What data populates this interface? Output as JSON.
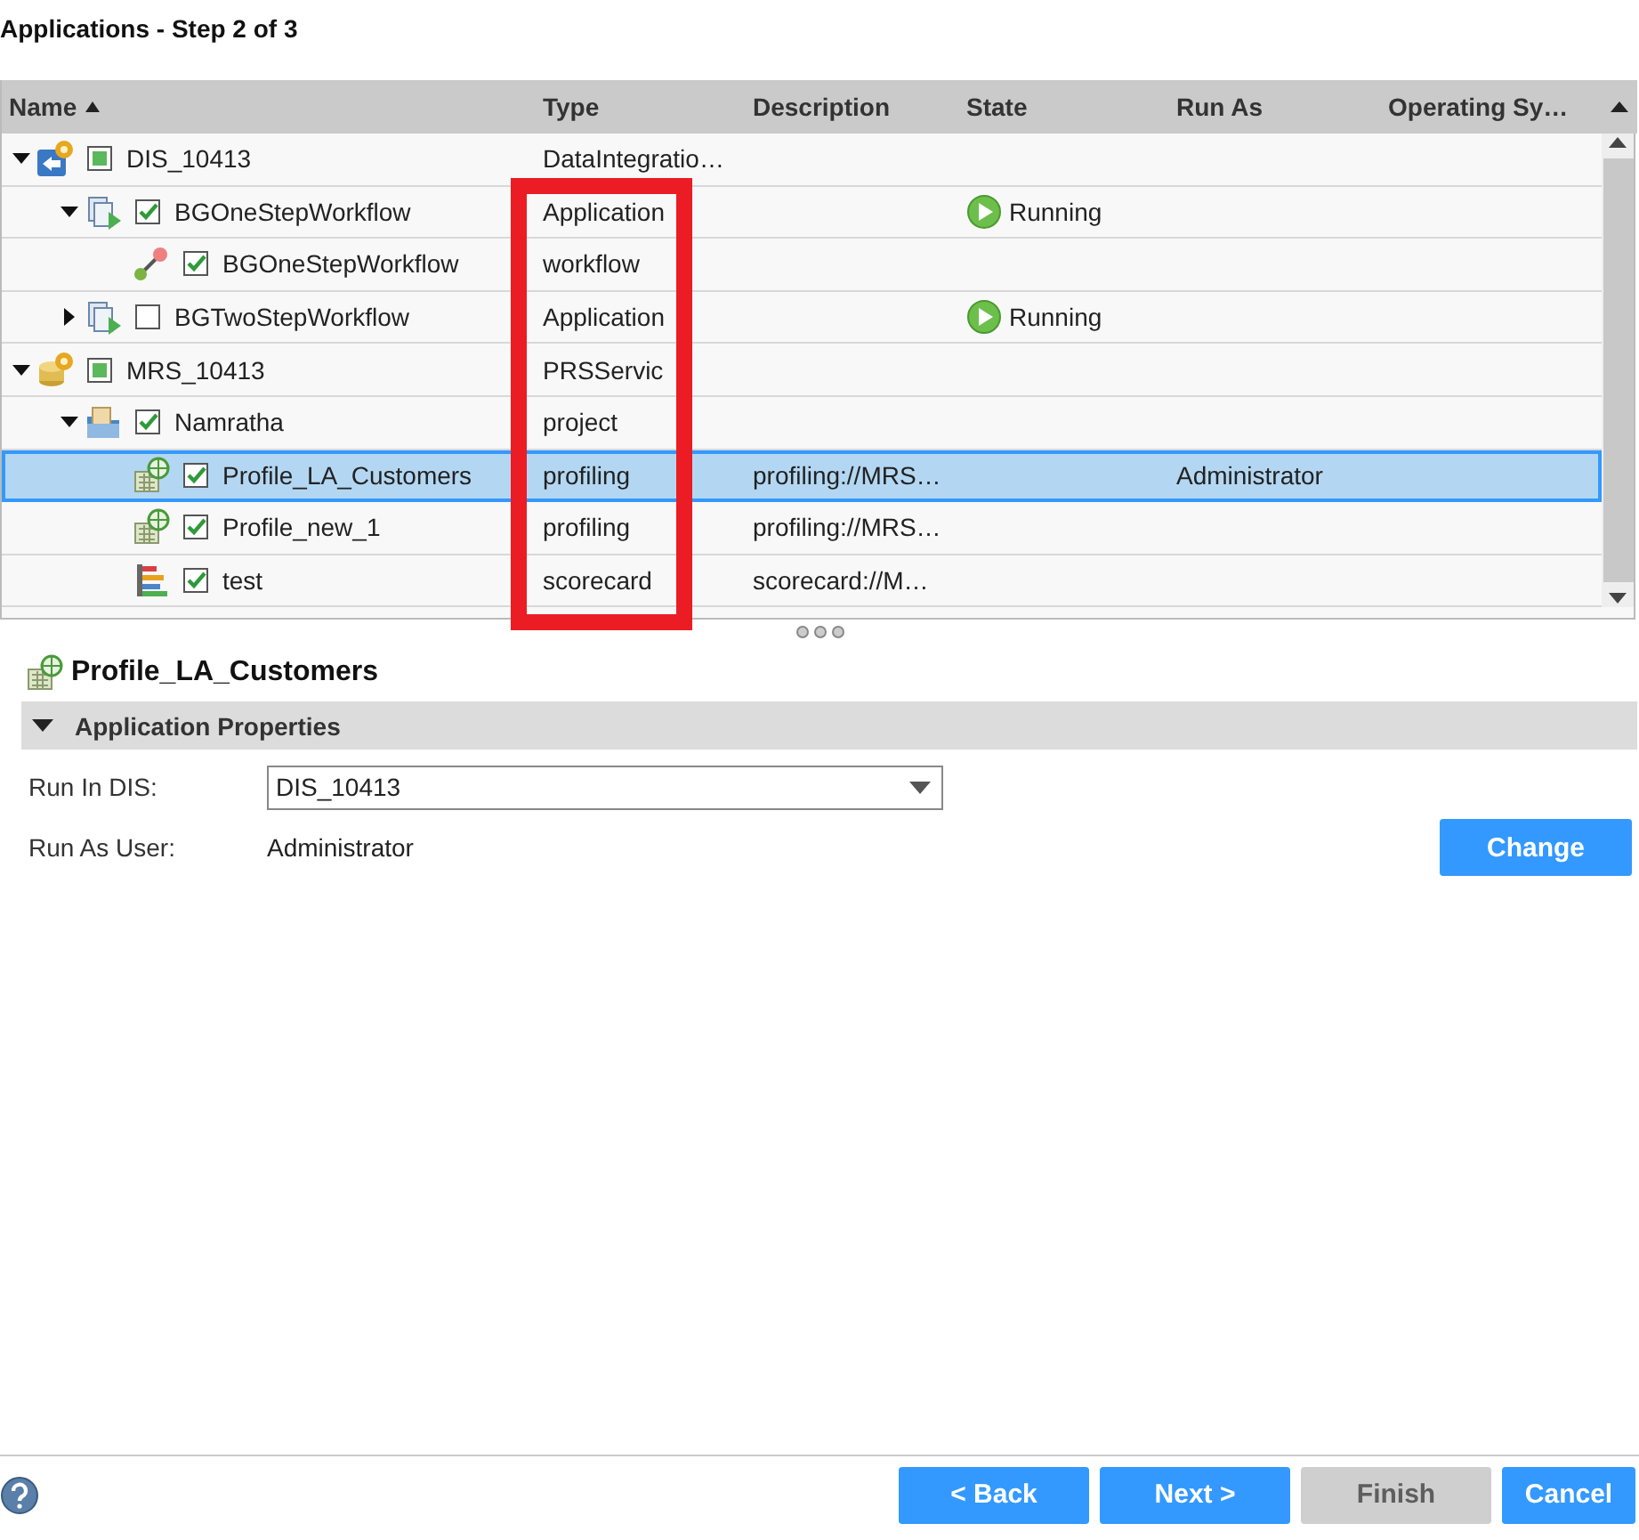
{
  "window": {
    "title": "Applications - Step 2 of 3"
  },
  "table": {
    "columns": [
      {
        "label": "Name",
        "sorted": true
      },
      {
        "label": "Type",
        "sorted": false
      },
      {
        "label": "Description",
        "sorted": false
      },
      {
        "label": "State",
        "sorted": false
      },
      {
        "label": "Run As",
        "sorted": false
      },
      {
        "label": "Operating Sy…",
        "sorted": false
      }
    ],
    "rows": [
      {
        "name": "DIS_10413",
        "kind": "dis-service",
        "checked": true,
        "partial": true,
        "expanded": true,
        "selected": false,
        "type": "DataIntegratio…",
        "children": [
          {
            "name": "BGOneStepWorkflow",
            "kind": "application",
            "checked": true,
            "partial": false,
            "expanded": true,
            "selected": false,
            "type": "Application",
            "state": "Running",
            "children": [
              {
                "name": "BGOneStepWorkflow",
                "kind": "workflow",
                "checked": true,
                "partial": false,
                "selected": false,
                "type": "workflow"
              }
            ]
          },
          {
            "name": "BGTwoStepWorkflow",
            "kind": "application",
            "checked": false,
            "partial": false,
            "expanded": false,
            "selected": false,
            "type": "Application",
            "state": "Running"
          }
        ]
      },
      {
        "name": "MRS_10413",
        "kind": "mrs-service",
        "checked": true,
        "partial": true,
        "expanded": true,
        "selected": false,
        "type": "PRSServic",
        "children": [
          {
            "name": "Namratha",
            "kind": "project",
            "checked": true,
            "partial": false,
            "expanded": true,
            "selected": false,
            "type": "project",
            "children": [
              {
                "name": "Profile_LA_Customers",
                "kind": "profile",
                "checked": true,
                "partial": false,
                "selected": true,
                "type": "profiling",
                "description": "profiling://MRS…",
                "run_as": "Administrator"
              },
              {
                "name": "Profile_new_1",
                "kind": "profile",
                "checked": true,
                "partial": false,
                "selected": false,
                "type": "profiling",
                "description": "profiling://MRS…"
              },
              {
                "name": "test",
                "kind": "scorecard",
                "checked": true,
                "partial": false,
                "selected": false,
                "type": "scorecard",
                "description": "scorecard://M…"
              }
            ]
          }
        ]
      }
    ]
  },
  "details": {
    "title": "Profile_LA_Customers",
    "kind": "profile",
    "section": {
      "label": "Application Properties",
      "expanded": true
    },
    "run_in_dis": {
      "label": "Run In DIS:",
      "value": "DIS_10413"
    },
    "run_as_user": {
      "label": "Run As User:",
      "value": "Administrator"
    },
    "change_button": "Change"
  },
  "buttons": [
    {
      "label": "< Back",
      "disabled": false
    },
    {
      "label": "Next >",
      "disabled": false
    },
    {
      "label": "Finish",
      "disabled": true
    },
    {
      "label": "Cancel",
      "disabled": false
    }
  ]
}
